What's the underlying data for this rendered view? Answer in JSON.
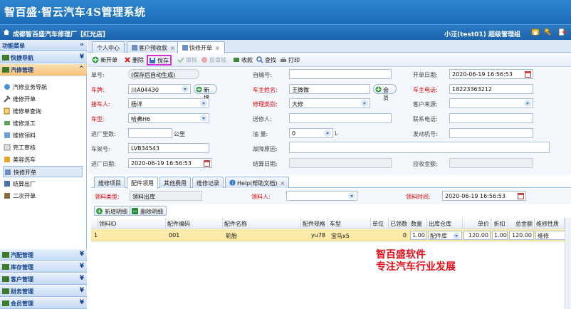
{
  "brand": "智百盛·智云汽车4S管理系统",
  "titlebar": {
    "shop": "成都智百盛汽车修理厂【红光店】",
    "user": "小汪(test01)  超级管理组"
  },
  "sidebar": {
    "title": "功能菜单",
    "sections_top": [
      {
        "label": "快捷导航"
      },
      {
        "label": "汽修管理"
      }
    ],
    "items": [
      {
        "label": "汽修业务导航"
      },
      {
        "label": "维修开单"
      },
      {
        "label": "维修单查询"
      },
      {
        "label": "维修派工"
      },
      {
        "label": "维修领料"
      },
      {
        "label": "完工审核"
      },
      {
        "label": "美容洗车"
      },
      {
        "label": "快修开单"
      },
      {
        "label": "结算出厂"
      },
      {
        "label": "二次开单"
      }
    ],
    "sections_bottom": [
      {
        "label": "汽配管理"
      },
      {
        "label": "库存管理"
      },
      {
        "label": "客户管理"
      },
      {
        "label": "财务管理"
      },
      {
        "label": "会员管理"
      }
    ]
  },
  "tabs": [
    {
      "label": "个人中心"
    },
    {
      "label": "客户预收款"
    },
    {
      "label": "快修开单"
    }
  ],
  "toolbar": {
    "new": "新开单",
    "delete": "删除",
    "save": "保存",
    "audit": "审核",
    "unaudit": "反审核",
    "collect": "收款",
    "find": "查找",
    "print": "打印"
  },
  "form": {
    "order_no": {
      "label": "单号:",
      "value": "(保存后自动生成)"
    },
    "self_no": {
      "label": "自编号:",
      "value": ""
    },
    "open_date": {
      "label": "开单日期:",
      "value": "2020-06-19 16:56:53"
    },
    "plate": {
      "label": "车牌:",
      "value": "川A04430",
      "btn": "新增"
    },
    "owner_name": {
      "label": "车主姓名:",
      "value": "王微微",
      "btn": "会员"
    },
    "owner_phone": {
      "label": "车主电话:",
      "value": "18223363212"
    },
    "receiver": {
      "label": "接车人:",
      "value": "杨洋"
    },
    "repair_type": {
      "label": "修理类别:",
      "value": "大修"
    },
    "customer_source": {
      "label": "客户来源:",
      "value": ""
    },
    "car_model": {
      "label": "车型:",
      "value": "哈弗H6"
    },
    "sender": {
      "label": "送修人:",
      "value": ""
    },
    "contact_phone": {
      "label": "联系电话:",
      "value": ""
    },
    "mileage": {
      "label": "进厂里数:",
      "value": "",
      "unit": "公里"
    },
    "fuel": {
      "label": "油  量:",
      "value": "0",
      "unit": "L"
    },
    "engine_no": {
      "label": "发动机号:",
      "value": ""
    },
    "vin": {
      "label": "车架号:",
      "value": "LVB34543"
    },
    "fault": {
      "label": "故障原因:",
      "value": ""
    },
    "in_date": {
      "label": "进厂日期:",
      "value": "2020-06-19 16:56:53"
    },
    "settle_date": {
      "label": "结算日期:",
      "value": ""
    },
    "receivable": {
      "label": "应收金额:",
      "value": ""
    }
  },
  "subtabs": [
    {
      "label": "维修项目"
    },
    {
      "label": "配件领用"
    },
    {
      "label": "其他费用"
    },
    {
      "label": "维修记录"
    },
    {
      "label": "Help(帮助文档)"
    }
  ],
  "subform": {
    "type": {
      "label": "领料类型:",
      "value": "领料出库"
    },
    "person": {
      "label": "领料人:",
      "value": ""
    },
    "time": {
      "label": "领料时间:",
      "value": "2020-06-19 16:56:53"
    }
  },
  "subtools": {
    "add": "新增明细",
    "del": "删除明细"
  },
  "grid": {
    "headers": [
      "领料ID",
      "配件编码",
      "配件名称",
      "配件规格",
      "车型",
      "单位",
      "已领数",
      "数量",
      "出库仓库",
      "单价",
      "折扣",
      "总金额",
      "维修性质"
    ],
    "rows": [
      {
        "no": "1",
        "id": "",
        "code": "001",
        "name": "轮胎",
        "spec": "yu78",
        "model": "宝马x5",
        "unit": "",
        "taken": "0",
        "qty": "1.00",
        "warehouse": "配件库",
        "price": "120.00",
        "discount": "1.00",
        "total": "120.00",
        "nature": "维修"
      }
    ]
  },
  "promo": {
    "line1": "智百盛软件",
    "line2": "专注汽车行业发展"
  }
}
